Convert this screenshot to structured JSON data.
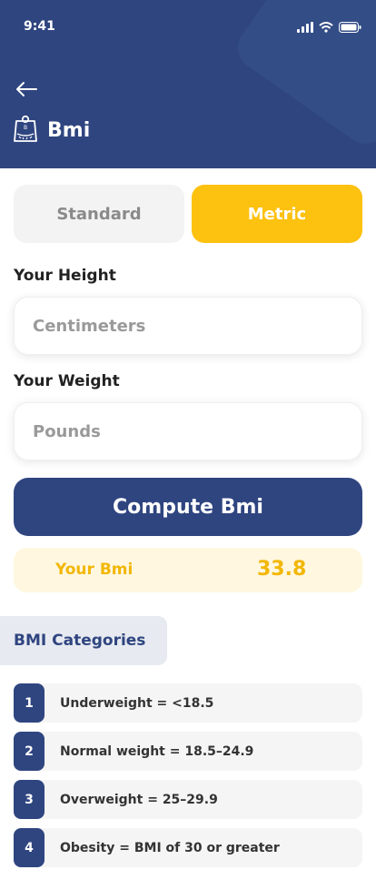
{
  "status": {
    "time": "9:41"
  },
  "header": {
    "title": "Bmi"
  },
  "units": {
    "standard_label": "Standard",
    "metric_label": "Metric",
    "selected": "Metric"
  },
  "height": {
    "label": "Your Height",
    "placeholder": "Centimeters"
  },
  "weight": {
    "label": "Your Weight",
    "placeholder": "Pounds"
  },
  "compute": {
    "label": "Compute Bmi"
  },
  "result": {
    "label": "Your Bmi",
    "value": "33.8"
  },
  "categories": {
    "title": "BMI Categories",
    "items": [
      {
        "num": "1",
        "text": "Underweight = <18.5"
      },
      {
        "num": "2",
        "text": "Normal weight = 18.5–24.9"
      },
      {
        "num": "3",
        "text": "Overweight = 25–29.9"
      },
      {
        "num": "4",
        "text": "Obesity = BMI of 30 or greater"
      }
    ]
  },
  "colors": {
    "primary": "#2f4580",
    "accent": "#fdc10f",
    "result_bg": "#fff7e0"
  },
  "icons": [
    "back-arrow-icon",
    "scale-icon",
    "signal-icon",
    "wifi-icon",
    "battery-icon"
  ]
}
